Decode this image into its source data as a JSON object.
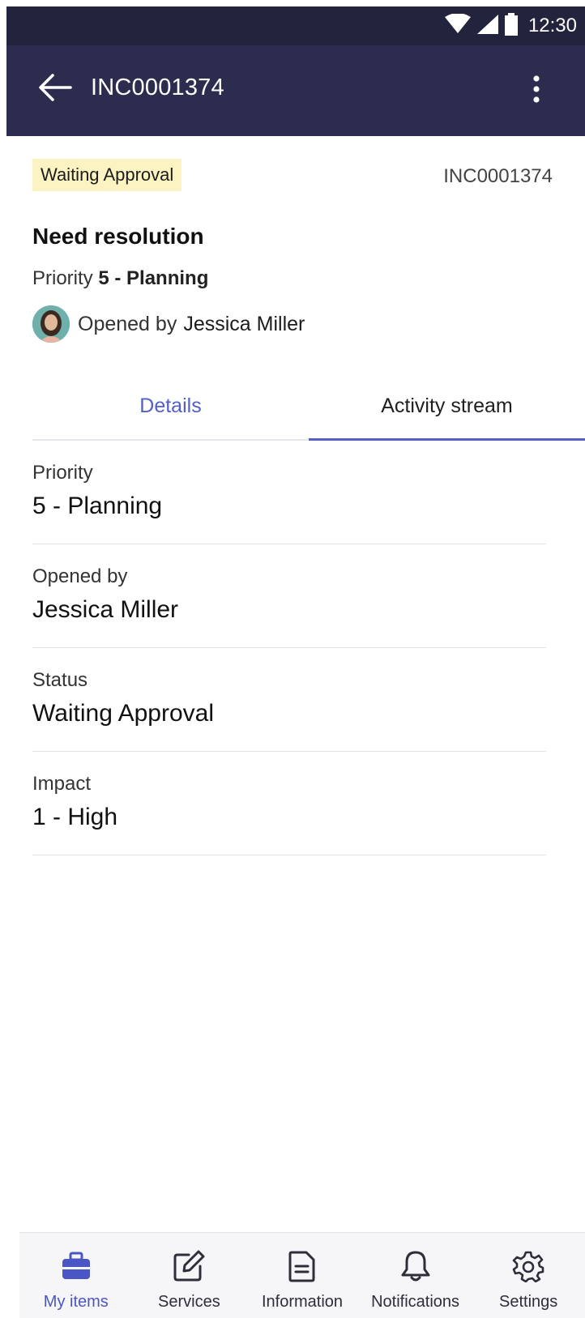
{
  "status_bar": {
    "time": "12:30",
    "icons": [
      "wifi-icon",
      "signal-icon",
      "battery-icon"
    ]
  },
  "app_bar": {
    "title": "INC0001374",
    "back_icon": "arrow-left-icon",
    "menu_icon": "more-vertical-icon"
  },
  "record": {
    "status_badge": "Waiting Approval",
    "number": "INC0001374",
    "short_description": "Need resolution",
    "priority_label": "Priority",
    "priority_value": "5 -  Planning",
    "opened_by_label": "Opened by",
    "opened_by_value": "Jessica Miller"
  },
  "tabs": [
    {
      "label": "Details",
      "selected": false
    },
    {
      "label": "Activity stream",
      "selected": true
    }
  ],
  "fields": [
    {
      "label": "Priority",
      "value": "5 -  Planning"
    },
    {
      "label": "Opened by",
      "value": "Jessica Miller"
    },
    {
      "label": "Status",
      "value": "Waiting Approval"
    },
    {
      "label": "Impact",
      "value": "1 - High"
    }
  ],
  "bottom_nav": [
    {
      "label": "My items",
      "icon": "briefcase-icon",
      "active": true
    },
    {
      "label": "Services",
      "icon": "edit-icon",
      "active": false
    },
    {
      "label": "Information",
      "icon": "document-icon",
      "active": false
    },
    {
      "label": "Notifications",
      "icon": "bell-icon",
      "active": false
    },
    {
      "label": "Settings",
      "icon": "gear-icon",
      "active": false
    }
  ],
  "colors": {
    "app_bar": "#2c2c4e",
    "status_bar": "#22233d",
    "accent": "#5460c7",
    "badge_bg": "#fbf3c2"
  }
}
